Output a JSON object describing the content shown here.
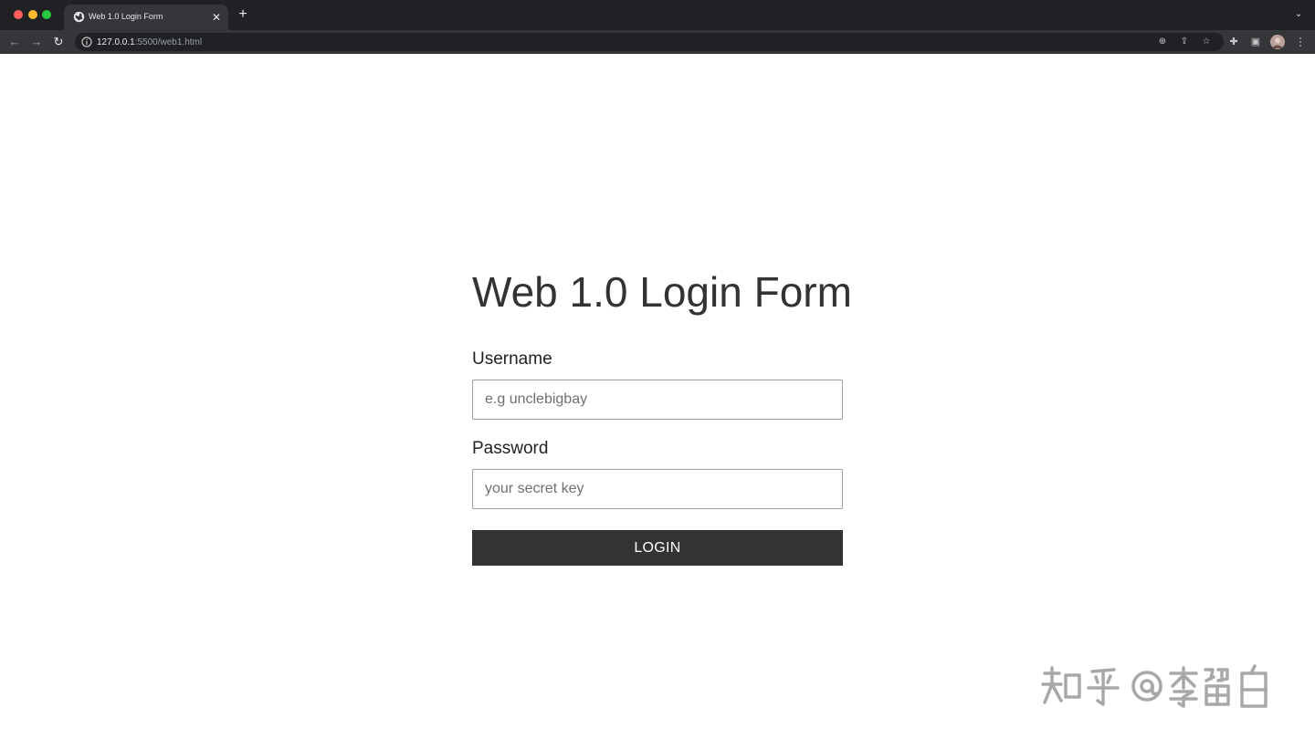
{
  "browser": {
    "tab": {
      "title": "Web 1.0 Login Form",
      "close_icon": "close-icon",
      "favicon": "globe-icon"
    },
    "new_tab_icon": "plus-icon",
    "tab_search_icon": "chevron-down-icon",
    "toolbar": {
      "back_icon": "arrow-left-icon",
      "forward_icon": "arrow-right-icon",
      "reload_icon": "reload-icon",
      "url_host": "127.0.0.1",
      "url_path": ":5500/web1.html",
      "site_info_icon": "info-icon",
      "zoom_icon": "zoom-icon",
      "share_icon": "share-icon",
      "bookmark_icon": "star-icon",
      "extensions_icon": "puzzle-icon",
      "side_panel_icon": "side-panel-icon",
      "profile_icon": "avatar-icon",
      "menu_icon": "kebab-menu-icon"
    },
    "colors": {
      "tabbar": "#202124",
      "toolbar": "#35363a",
      "omnibox": "#202124"
    }
  },
  "page": {
    "title": "Web 1.0 Login Form",
    "username": {
      "label": "Username",
      "value": "",
      "placeholder": "e.g unclebigbay"
    },
    "password": {
      "label": "Password",
      "value": "",
      "placeholder": "your secret key"
    },
    "login_button": {
      "label": "LOGIN"
    },
    "colors": {
      "text": "#333333",
      "button_bg": "#333333",
      "button_text": "#ffffff",
      "input_border": "#9e9e9e",
      "background": "#ffffff"
    }
  },
  "watermark": {
    "text": "知乎 @李留白"
  }
}
